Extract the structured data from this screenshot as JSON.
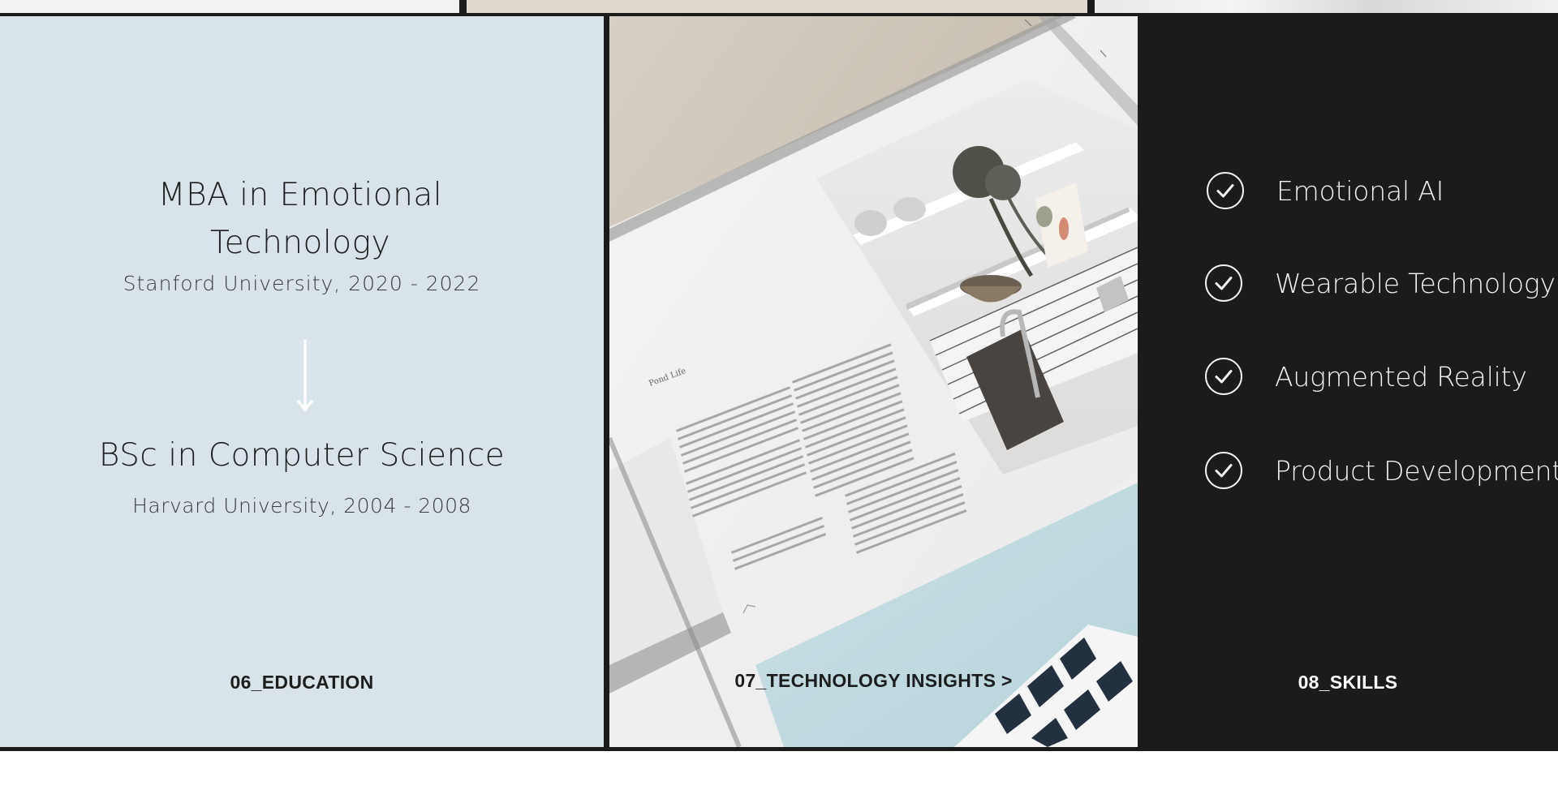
{
  "education": {
    "degrees": [
      {
        "title": "MBA in Emotional Technology",
        "institution": "Stanford University, 2020 - 2022"
      },
      {
        "title": "BSc in Computer Science",
        "institution": "Harvard University, 2004 - 2008"
      }
    ],
    "label": "06_EDUCATION",
    "background": "#d8e4ea"
  },
  "technology": {
    "label": "07_TECHNOLOGY INSIGHTS >",
    "magazine_heading": "Pond Life"
  },
  "skills": {
    "items": [
      {
        "label": "Emotional AI",
        "icon": "check-circle-icon"
      },
      {
        "label": "Wearable Technology",
        "icon": "check-circle-icon"
      },
      {
        "label": "Augmented Reality",
        "icon": "check-circle-icon"
      },
      {
        "label": "Product Development",
        "icon": "check-circle-icon"
      }
    ],
    "label": "08_SKILLS",
    "background": "#1b1b1b"
  },
  "colors": {
    "divider": "#1b1b1b",
    "text_dark": "#1d1d1d",
    "text_light": "#f2f2f2",
    "accent_light_blue": "#d8e4ea"
  }
}
